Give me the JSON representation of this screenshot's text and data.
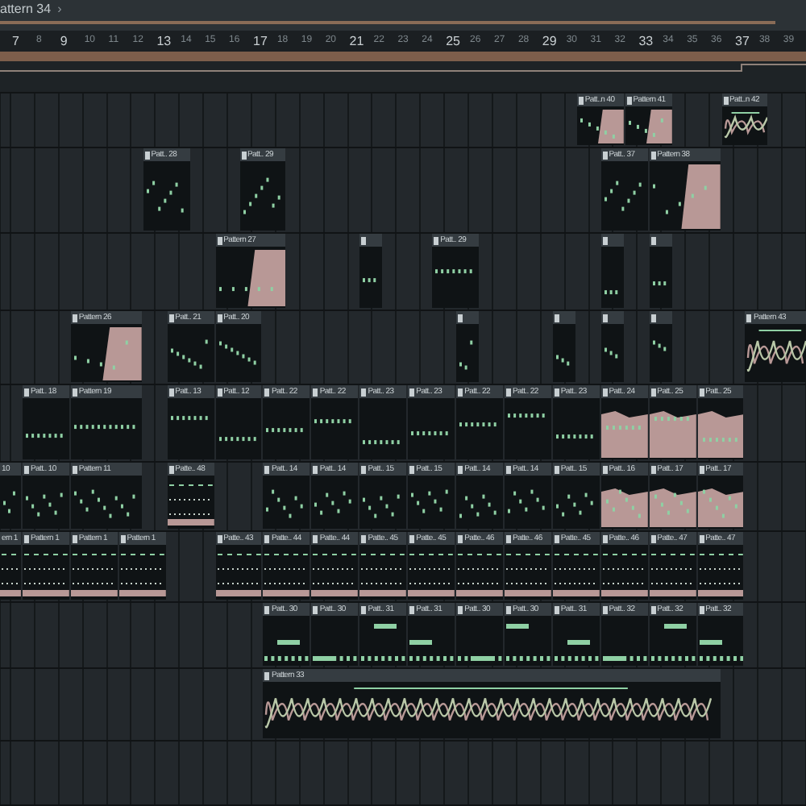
{
  "header": {
    "title": "attern 34",
    "arrow": "›"
  },
  "ruler": [
    {
      "label": "7",
      "kind": "major"
    },
    {
      "label": "8",
      "kind": "minor"
    },
    {
      "label": "9",
      "kind": "major"
    },
    {
      "label": "10",
      "kind": "minor"
    },
    {
      "label": "11",
      "kind": "minor"
    },
    {
      "label": "12",
      "kind": "minor"
    },
    {
      "label": "13",
      "kind": "major"
    },
    {
      "label": "14",
      "kind": "minor"
    },
    {
      "label": "15",
      "kind": "minor"
    },
    {
      "label": "16",
      "kind": "minor"
    },
    {
      "label": "17",
      "kind": "major"
    },
    {
      "label": "18",
      "kind": "minor"
    },
    {
      "label": "19",
      "kind": "minor"
    },
    {
      "label": "20",
      "kind": "minor"
    },
    {
      "label": "21",
      "kind": "major"
    },
    {
      "label": "22",
      "kind": "minor"
    },
    {
      "label": "23",
      "kind": "minor"
    },
    {
      "label": "24",
      "kind": "minor"
    },
    {
      "label": "25",
      "kind": "major"
    },
    {
      "label": "26",
      "kind": "minor"
    },
    {
      "label": "27",
      "kind": "minor"
    },
    {
      "label": "28",
      "kind": "minor"
    },
    {
      "label": "29",
      "kind": "major"
    },
    {
      "label": "30",
      "kind": "minor"
    },
    {
      "label": "31",
      "kind": "minor"
    },
    {
      "label": "32",
      "kind": "minor"
    },
    {
      "label": "33",
      "kind": "major"
    },
    {
      "label": "34",
      "kind": "minor"
    },
    {
      "label": "35",
      "kind": "minor"
    },
    {
      "label": "36",
      "kind": "minor"
    },
    {
      "label": "37",
      "kind": "major"
    },
    {
      "label": "38",
      "kind": "minor"
    },
    {
      "label": "39",
      "kind": "minor"
    }
  ],
  "tracks": [
    {
      "clips": [
        {
          "label": "Patt..n 40",
          "kind": "half"
        },
        {
          "label": "Pattern 41",
          "kind": "half"
        },
        {
          "label": "Patt..n 42",
          "kind": "curves"
        }
      ]
    },
    {
      "clips": [
        {
          "label": "Patt.. 28",
          "kind": "notes"
        },
        {
          "label": "Patt.. 29",
          "kind": "notes"
        },
        {
          "label": "Patt.. 37",
          "kind": "notes"
        },
        {
          "label": "Pattern 38",
          "kind": "half"
        }
      ]
    },
    {
      "clips": [
        {
          "label": "Pattern 27",
          "kind": "half"
        },
        {
          "kind": "notes"
        },
        {
          "label": "Patt.. 29",
          "kind": "notes"
        },
        {
          "kind": "notes"
        },
        {
          "kind": "notes"
        }
      ]
    },
    {
      "clips": [
        {
          "label": "Pattern 26",
          "kind": "half"
        },
        {
          "label": "Patt.. 21",
          "kind": "notes"
        },
        {
          "label": "Patt.. 20",
          "kind": "notes"
        },
        {
          "kind": "notes"
        },
        {
          "kind": "notes"
        },
        {
          "kind": "notes"
        },
        {
          "kind": "notes"
        },
        {
          "label": "Pattern 43",
          "kind": "curves"
        }
      ]
    },
    {
      "clips": [
        {
          "label": "Patt.. 18",
          "kind": "notes"
        },
        {
          "label": "Pattern 19",
          "kind": "notes"
        },
        {
          "label": "Patt.. 13",
          "kind": "notes"
        },
        {
          "label": "Patt.. 12",
          "kind": "notes"
        },
        {
          "label": "Patt.. 22",
          "kind": "notes"
        },
        {
          "label": "Patt.. 22",
          "kind": "notes"
        },
        {
          "label": "Patt.. 23",
          "kind": "notes"
        },
        {
          "label": "Patt.. 23",
          "kind": "notes"
        },
        {
          "label": "Patt.. 22",
          "kind": "notes"
        },
        {
          "label": "Patt.. 22",
          "kind": "notes"
        },
        {
          "label": "Patt.. 23",
          "kind": "notes"
        },
        {
          "label": "Patt.. 24",
          "kind": "audio"
        },
        {
          "label": "Patt.. 25",
          "kind": "audio"
        },
        {
          "label": "Patt.. 25",
          "kind": "audio"
        }
      ]
    },
    {
      "clips": [
        {
          "label": "10",
          "kind": "notes"
        },
        {
          "label": "Patt.. 10",
          "kind": "notes"
        },
        {
          "label": "Pattern 11",
          "kind": "notes"
        },
        {
          "label": "Patte.. 48",
          "kind": "dots"
        },
        {
          "label": "Patt.. 14",
          "kind": "notes"
        },
        {
          "label": "Patt.. 14",
          "kind": "notes"
        },
        {
          "label": "Patt.. 15",
          "kind": "notes"
        },
        {
          "label": "Patt.. 15",
          "kind": "notes"
        },
        {
          "label": "Patt.. 14",
          "kind": "notes"
        },
        {
          "label": "Patt.. 14",
          "kind": "notes"
        },
        {
          "label": "Patt.. 15",
          "kind": "notes"
        },
        {
          "label": "Patt.. 16",
          "kind": "audio"
        },
        {
          "label": "Patt.. 17",
          "kind": "audio"
        },
        {
          "label": "Patt.. 17",
          "kind": "audio"
        }
      ]
    },
    {
      "clips": [
        {
          "label": "ern 1",
          "kind": "dots"
        },
        {
          "label": "Pattern 1",
          "kind": "dots"
        },
        {
          "label": "Pattern 1",
          "kind": "dots"
        },
        {
          "label": "Pattern 1",
          "kind": "dots"
        },
        {
          "label": "Patte.. 43",
          "kind": "dots"
        },
        {
          "label": "Patte.. 44",
          "kind": "dots"
        },
        {
          "label": "Patte.. 44",
          "kind": "dots"
        },
        {
          "label": "Patte.. 45",
          "kind": "dots"
        },
        {
          "label": "Patte.. 45",
          "kind": "dots"
        },
        {
          "label": "Patte.. 46",
          "kind": "dots"
        },
        {
          "label": "Patte.. 46",
          "kind": "dots"
        },
        {
          "label": "Patte.. 45",
          "kind": "dots"
        },
        {
          "label": "Patte.. 46",
          "kind": "dots"
        },
        {
          "label": "Patte.. 47",
          "kind": "dots"
        },
        {
          "label": "Patte.. 47",
          "kind": "dots"
        }
      ]
    },
    {
      "clips": [
        {
          "label": "Patt.. 30",
          "kind": "steps"
        },
        {
          "label": "Patt.. 30",
          "kind": "steps"
        },
        {
          "label": "Patt.. 31",
          "kind": "steps"
        },
        {
          "label": "Patt.. 31",
          "kind": "steps"
        },
        {
          "label": "Patt.. 30",
          "kind": "steps"
        },
        {
          "label": "Patt.. 30",
          "kind": "steps"
        },
        {
          "label": "Patt.. 31",
          "kind": "steps"
        },
        {
          "label": "Patt.. 32",
          "kind": "steps"
        },
        {
          "label": "Patt.. 32",
          "kind": "steps"
        },
        {
          "label": "Patt.. 32",
          "kind": "steps"
        }
      ]
    },
    {
      "clips": [
        {
          "label": "Pattern 33",
          "kind": "curves"
        }
      ]
    }
  ]
}
